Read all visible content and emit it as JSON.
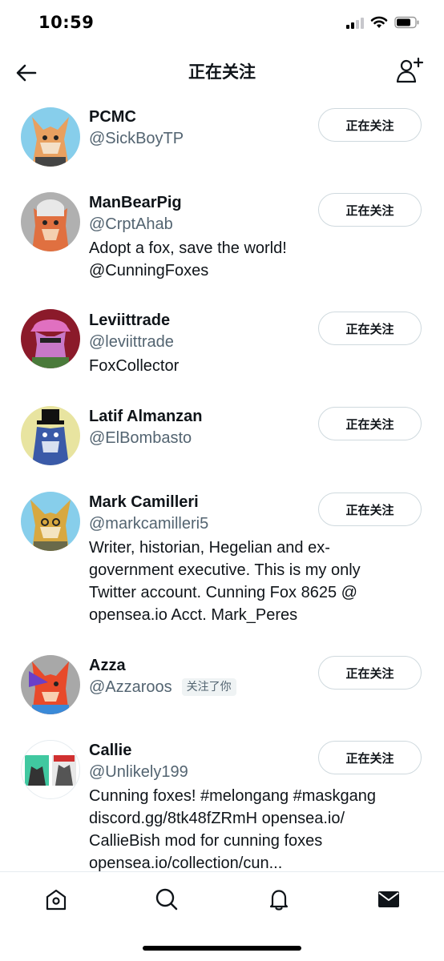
{
  "status_bar": {
    "time": "10:59",
    "icons": [
      "cellular-signal-icon",
      "wifi-icon",
      "battery-icon"
    ]
  },
  "header": {
    "title": "正在关注",
    "back_icon": "arrow-left-icon",
    "add_icon": "add-user-icon"
  },
  "users": [
    {
      "name": "PCMC",
      "handle": "@SickBoyTP",
      "bio": "",
      "follows_you": "",
      "button": "正在关注",
      "avatar_bg": "#87ceeb",
      "avatar_fg": "#e8a060"
    },
    {
      "name": "ManBearPig",
      "handle": "@CrptAhab",
      "bio": "Adopt a fox, save the world! @CunningFoxes",
      "follows_you": "",
      "button": "正在关注",
      "avatar_bg": "#b0b0b0",
      "avatar_fg": "#e07040"
    },
    {
      "name": "Leviittrade",
      "handle": "@leviittrade",
      "bio": "FoxCollector",
      "follows_you": "",
      "button": "正在关注",
      "avatar_bg": "#8b1a2a",
      "avatar_fg": "#c878c8"
    },
    {
      "name": "Latif Almanzan",
      "handle": "@ElBombasto",
      "bio": "",
      "follows_you": "",
      "button": "正在关注",
      "avatar_bg": "#e8e4a0",
      "avatar_fg": "#3a5aa8"
    },
    {
      "name": "Mark Camilleri",
      "handle": "@markcamilleri5",
      "bio": "Writer, historian, Hegelian and ex-government executive. This is my only Twitter account. Cunning Fox 8625 @ opensea.io Acct. Mark_Peres",
      "follows_you": "",
      "button": "正在关注",
      "avatar_bg": "#87ceeb",
      "avatar_fg": "#d8a840"
    },
    {
      "name": "Azza",
      "handle": "@Azzaroos",
      "bio": "",
      "follows_you": "关注了你",
      "button": "正在关注",
      "avatar_bg": "#a8a8a8",
      "avatar_fg": "#e84a2a"
    },
    {
      "name": "Callie",
      "handle": "@Unlikely199",
      "bio": "Cunning foxes! #melongang #maskgang discord.gg/8tk48fZRmH opensea.io/ CallieBish mod for cunning foxes opensea.io/collection/cun...",
      "follows_you": "",
      "button": "正在关注",
      "avatar_bg": "#ffffff",
      "avatar_fg": "#40c8a0"
    }
  ],
  "tab_bar": {
    "tabs": [
      "home-icon",
      "search-icon",
      "notifications-icon",
      "messages-icon"
    ]
  }
}
